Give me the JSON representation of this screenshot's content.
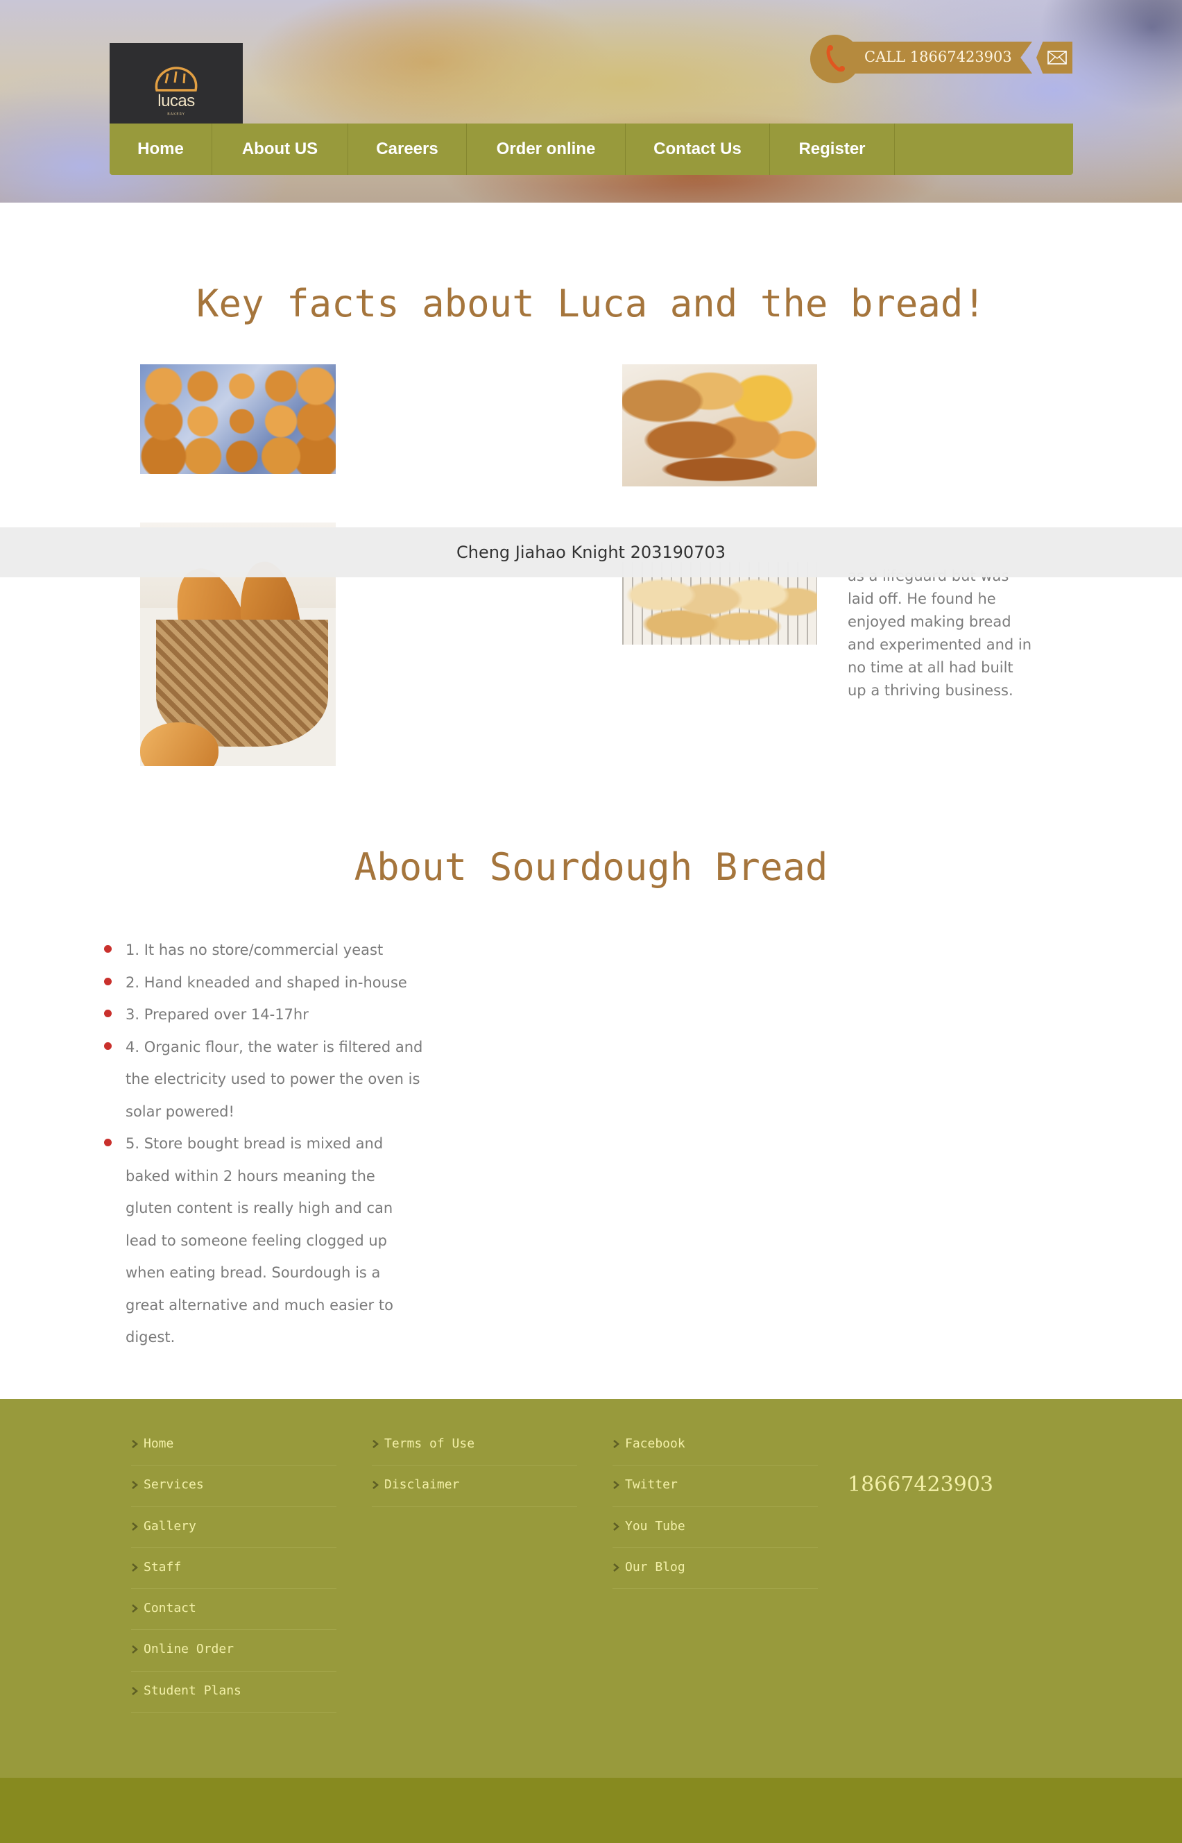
{
  "header": {
    "logo_text": "lucas",
    "logo_sub": "BAKERY",
    "call_text": "CALL  18667423903",
    "nav": [
      {
        "label": "Home"
      },
      {
        "label": "About US"
      },
      {
        "label": "Careers"
      },
      {
        "label": "Order online"
      },
      {
        "label": "Contact Us"
      },
      {
        "label": "Register"
      }
    ]
  },
  "key_facts": {
    "title": "Key facts about Luca and the bread!",
    "story_text": "as a lifeguard but was laid off. He found he enjoyed making bread and experimented and in no time at all had built up a thriving business."
  },
  "watermark": "Cheng Jiahao Knight 203190703",
  "sourdough": {
    "title": "About Sourdough Bread",
    "items": [
      "1. It has no store/commercial yeast",
      "2. Hand kneaded and shaped in-house",
      "3. Prepared over 14-17hr",
      "4. Organic flour, the water is filtered and the electricity used to power the oven is solar powered!",
      "5. Store bought bread is mixed and baked within 2 hours meaning the gluten content is really high and can lead to someone feeling clogged up when eating bread. Sourdough is a great alternative and much easier to digest."
    ]
  },
  "footer": {
    "col1": [
      "Home",
      "Services",
      "Gallery",
      "Staff",
      "Contact",
      "Online Order",
      "Student Plans"
    ],
    "col2": [
      "Terms of Use",
      "Disclaimer"
    ],
    "col3": [
      "Facebook",
      "Twitter",
      "You Tube",
      "Our Blog"
    ],
    "phone": "18667423903"
  },
  "colors": {
    "nav_bg": "#989a3c",
    "accent_brown": "#a5753c",
    "call_bg": "#b58a3e",
    "footer_bg": "#989a3c",
    "footer_bottom": "#878a1f",
    "footer_link": "#f3f0a8",
    "bullet": "#c9302c"
  }
}
